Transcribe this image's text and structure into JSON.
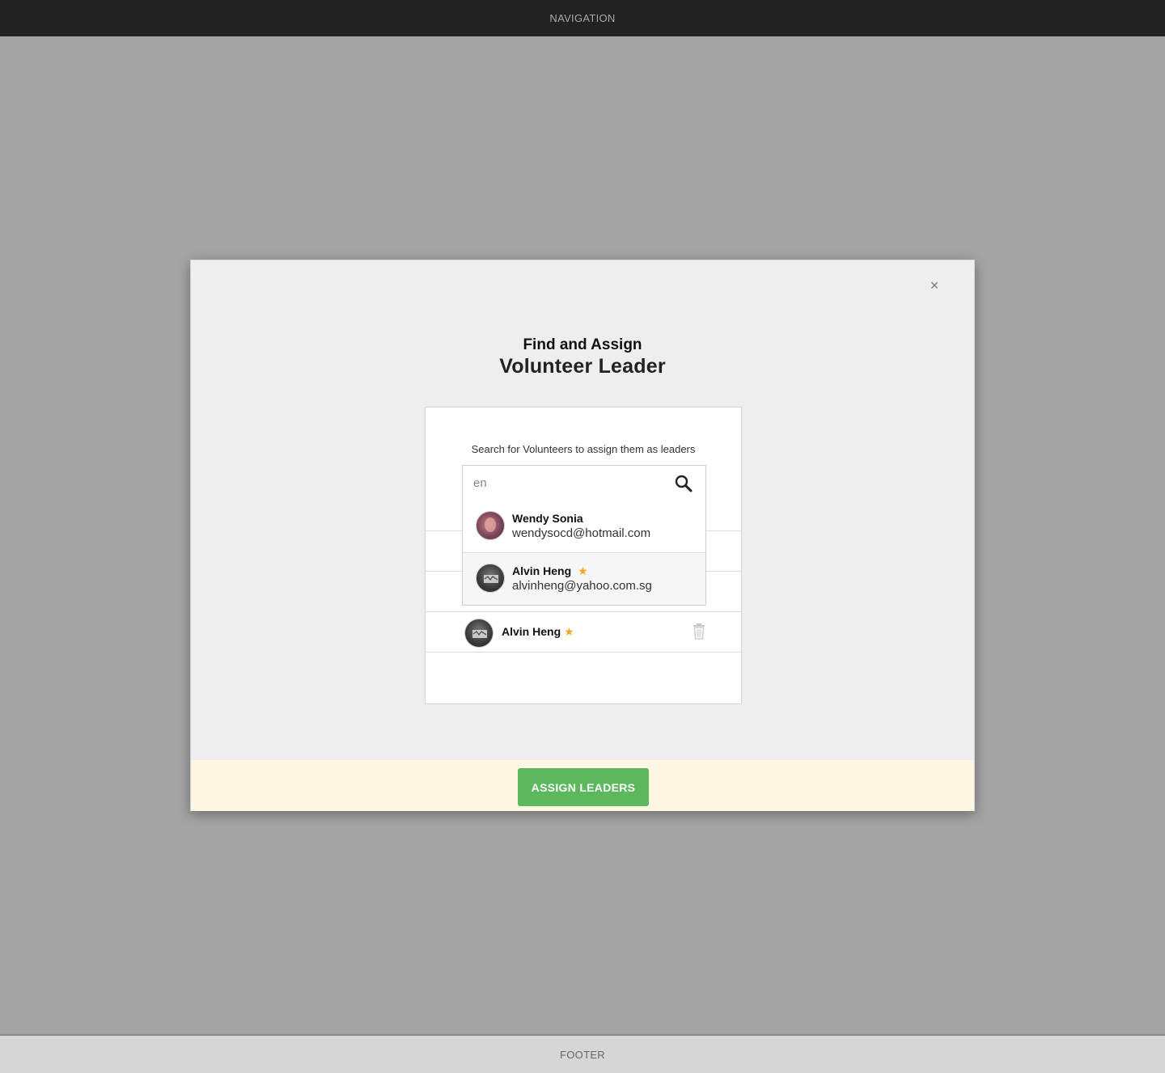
{
  "navigation": {
    "label": "NAVIGATION"
  },
  "footer": {
    "label": "FOOTER"
  },
  "modal": {
    "close_symbol": "×",
    "title_small": "Find and Assign",
    "title_large": "Volunteer Leader",
    "panel_label": "Search for Volunteers to assign them as leaders",
    "search": {
      "value": "en",
      "placeholder": ""
    },
    "dropdown_results": [
      {
        "name": "Wendy Sonia",
        "email": "wendysocd@hotmail.com",
        "starred": false,
        "avatar": "photo"
      },
      {
        "name": "Alvin Heng",
        "email": "alvinheng@yahoo.com.sg",
        "starred": true,
        "avatar": "logo"
      }
    ],
    "assigned_leaders": [
      {
        "name": "Alvin Heng",
        "starred": true
      }
    ],
    "assign_button_label": "ASSIGN LEADERS"
  },
  "colors": {
    "overlay": "#a4a4a4",
    "nav_bg": "#222222",
    "accent_green": "#5cb85c",
    "star": "#f5a623",
    "footer_bg": "#fdf7e4"
  },
  "icons": [
    "close-icon",
    "search-icon",
    "star-icon",
    "trash-icon"
  ]
}
